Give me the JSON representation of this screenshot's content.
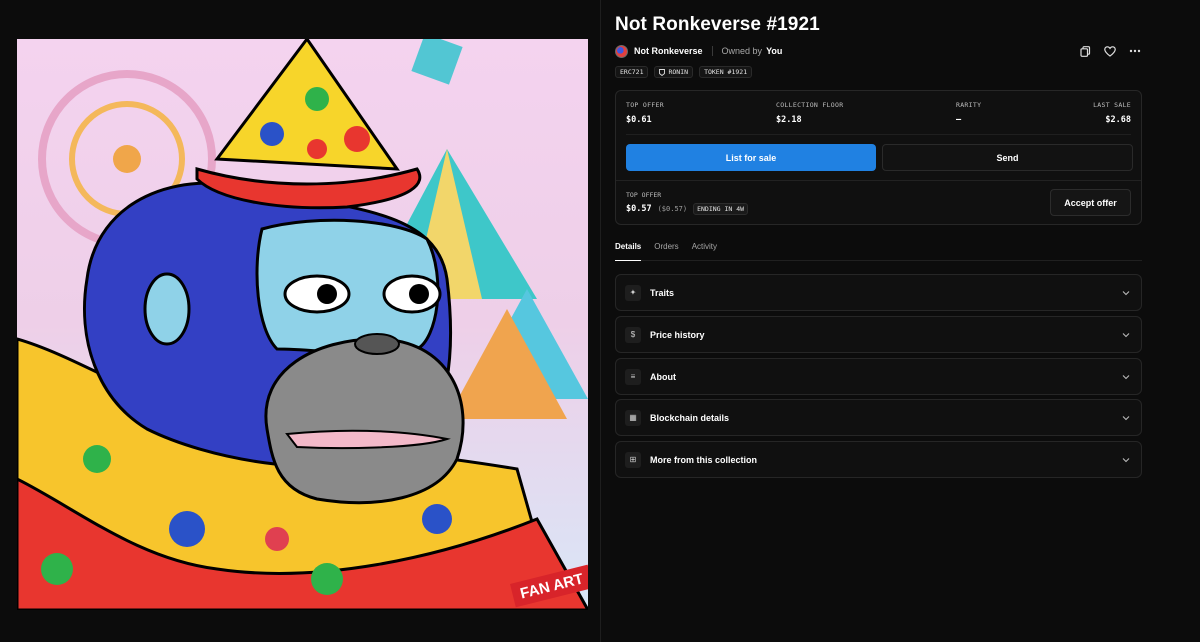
{
  "nft": {
    "title": "Not Ronkeverse #1921",
    "collection": "Not Ronkeverse",
    "owned_by_label": "Owned by",
    "owner": "You",
    "artwork_badge": "FAN ART",
    "chips": [
      "ERC721",
      "RONIN",
      "TOKEN #1921"
    ]
  },
  "stats": {
    "top_offer_label": "TOP OFFER",
    "top_offer_value": "$0.61",
    "floor_label": "COLLECTION FLOOR",
    "floor_value": "$2.18",
    "rarity_label": "RARITY",
    "rarity_value": "–",
    "last_sale_label": "LAST SALE",
    "last_sale_value": "$2.68"
  },
  "actions": {
    "list_label": "List for sale",
    "send_label": "Send",
    "accept_label": "Accept offer"
  },
  "offer": {
    "label": "TOP OFFER",
    "value": "$0.57",
    "usd": "($0.57)",
    "ending": "ENDING IN 4W"
  },
  "tabs": [
    "Details",
    "Orders",
    "Activity"
  ],
  "sections": [
    {
      "label": "Traits",
      "icon": "sparkle-icon",
      "glyph": "✦"
    },
    {
      "label": "Price history",
      "icon": "dollar-icon",
      "glyph": "$"
    },
    {
      "label": "About",
      "icon": "doc-edit-icon",
      "glyph": "≡"
    },
    {
      "label": "Blockchain details",
      "icon": "chain-grid-icon",
      "glyph": "▦"
    },
    {
      "label": "More from this collection",
      "icon": "grid-icon",
      "glyph": "⊞"
    }
  ],
  "colors": {
    "accent": "#2081e2",
    "background": "#0c0c0c"
  }
}
